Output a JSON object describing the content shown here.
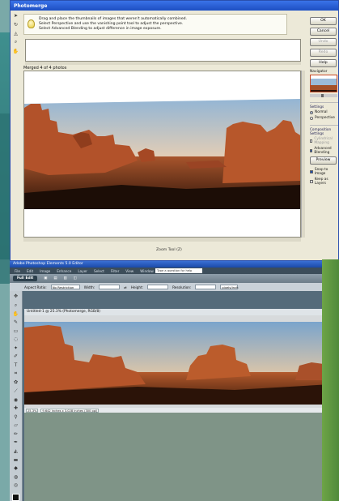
{
  "photomerge": {
    "title": "Photomerge",
    "instructions": [
      "Drag and place the thumbnails of images that weren't automatically combined.",
      "Select Perspective and use the vanishing point tool to adjust the perspective.",
      "Select Advanced Blending to adjust difference in image exposure."
    ],
    "merged_label": "Merged 4 of 4 photos",
    "zoom_label": "Zoom Tool (Z)",
    "buttons": {
      "ok": "OK",
      "cancel": "Cancel",
      "undo": "Undo",
      "redo": "Redo",
      "help": "Help"
    },
    "navigator_label": "Navigator",
    "settings": {
      "label": "Settings",
      "normal": "Normal",
      "perspective": "Perspective"
    },
    "composition": {
      "label": "Composition Settings",
      "cylindrical": "Cylindrical Mapping",
      "advanced": "Advanced Blending",
      "preview": "Preview"
    },
    "snap": "Snap to Image",
    "keep_layers": "Keep as Layers"
  },
  "editor": {
    "title": "Adobe Photoshop Elements 5.0 Editor",
    "menu": [
      "File",
      "Edit",
      "Image",
      "Enhance",
      "Layer",
      "Select",
      "Filter",
      "View",
      "Window",
      "Help"
    ],
    "help_box": "Type a question for help",
    "full_edit": "Full Edit",
    "options": {
      "aspect_label": "Aspect Ratio:",
      "aspect_value": "No Restriction",
      "width": "Width:",
      "height": "Height:",
      "resolution": "Resolution:",
      "resolution_unit": "pixels/inch"
    },
    "doc_tab": "Untitled-1 @ 25.3% (Photomerge, RGB/8)",
    "status_zoom": "25.3%",
    "status_size": "9.642 inches x 3.028 inches (300 ppi)"
  },
  "colors": {
    "sky_top": "#8fb4d6",
    "rock": "#b2522a",
    "titlebar": "#1d4fc2"
  }
}
